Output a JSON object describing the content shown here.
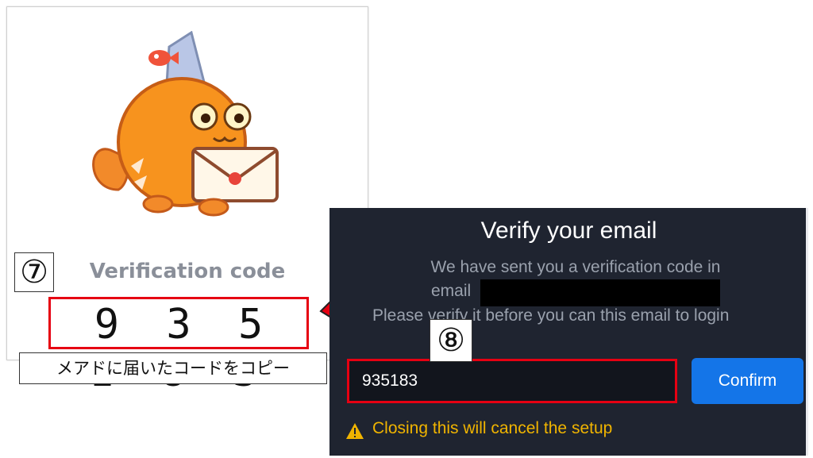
{
  "email_card": {
    "verification_label": "Verification code",
    "code": "9 3 5 1 8 3"
  },
  "annotations": {
    "step7": "⑦",
    "step7_note": "メアドに届いたコードをコピー",
    "step8": "⑧"
  },
  "dialog": {
    "title": "Verify your email",
    "desc_line1": "We have sent you a verification code in",
    "desc_line2_label": "email",
    "desc_line3": "Please verify it before you can this email to login",
    "input_value": "935183",
    "confirm_label": "Confirm",
    "warning_text": "Closing this will cancel the setup",
    "warning_icon": "warning-triangle-icon"
  },
  "colors": {
    "dialog_bg": "#1f2430",
    "accent_blue": "#1475e8",
    "highlight_red": "#e60012",
    "warning_yellow": "#f0b400"
  }
}
